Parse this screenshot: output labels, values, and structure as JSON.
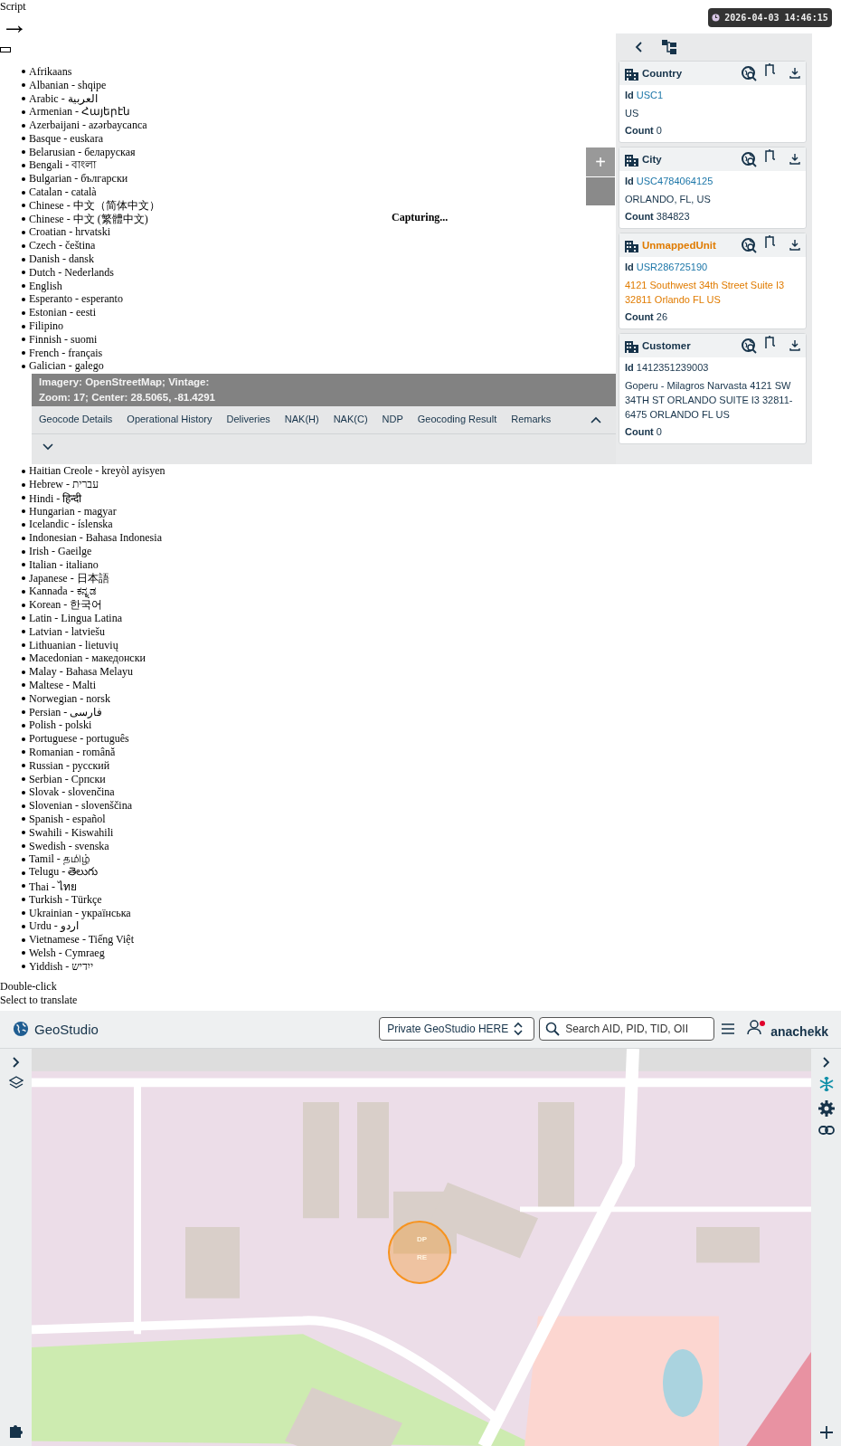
{
  "page_top": {
    "label": "Script",
    "arrow": "→"
  },
  "languages_top": [
    "Afrikaans",
    "Albanian - shqipe",
    "Arabic - العربية",
    "Armenian - Հայերէն",
    "Azerbaijani - azərbaycanca",
    "Basque - euskara",
    "Belarusian - беларуская",
    "Bengali - বাংলা",
    "Bulgarian - български",
    "Catalan - català",
    "Chinese - 中文（简体中文）",
    "Chinese - 中文 (繁體中文)",
    "Croatian - hrvatski",
    "Czech - čeština",
    "Danish - dansk",
    "Dutch - Nederlands",
    "English",
    "Esperanto - esperanto",
    "Estonian - eesti",
    "Filipino",
    "Finnish - suomi",
    "French - français",
    "Galician - galego"
  ],
  "languages_bottom": [
    "Haitian Creole - kreyòl ayisyen",
    "Hebrew - עברית",
    "Hindi - हिन्दी",
    "Hungarian - magyar",
    "Icelandic - íslenska",
    "Indonesian - Bahasa Indonesia",
    "Irish - Gaeilge",
    "Italian - italiano",
    "Japanese - 日本語",
    "Kannada - ಕನ್ನಡ",
    "Korean - 한국어",
    "Latin - Lingua Latina",
    "Latvian - latviešu",
    "Lithuanian - lietuvių",
    "Macedonian - македонски",
    "Malay - Bahasa Melayu",
    "Maltese - Malti",
    "Norwegian - norsk",
    "Persian - فارسی",
    "Polish - polski",
    "Portuguese - português",
    "Romanian - română",
    "Russian - русский",
    "Serbian - Српски",
    "Slovak - slovenčina",
    "Slovenian - slovenščina",
    "Spanish - español",
    "Swahili - Kiswahili",
    "Swedish - svenska",
    "Tamil - தமிழ்",
    "Telugu - తెలుగు",
    "Thai - ไทย",
    "Turkish - Türkçe",
    "Ukrainian - українська",
    "Urdu - اردو",
    "Vietnamese - Tiếng Việt",
    "Welsh - Cymraeg",
    "Yiddish - ייִדיש"
  ],
  "hints": [
    "Double-click",
    "Select to translate"
  ],
  "timestamp": "2026-04-03 14:46:15",
  "capture_status": "Capturing...",
  "map_controls": {
    "zoom_in": "+"
  },
  "map_info": [
    "Imagery: OpenStreetMap; Vintage:",
    "Zoom: 17; Center: 28.5065, -81.4291"
  ],
  "detail_tabs": [
    {
      "label": "Geocode Details",
      "selected": false
    },
    {
      "label": "Operational History",
      "selected": false
    },
    {
      "label": "Deliveries",
      "selected": false
    },
    {
      "label": "NAK(H)",
      "selected": false
    },
    {
      "label": "NAK(C)",
      "selected": false
    },
    {
      "label": "NDP",
      "selected": false
    },
    {
      "label": "Geocoding Result",
      "selected": false
    },
    {
      "label": "Remarks",
      "selected": false
    }
  ],
  "hierarchy": [
    {
      "title": "Country",
      "highlighted": false,
      "id_label": "Id",
      "id": "USC1",
      "id_linked": true,
      "address": "US",
      "count_label": "Count",
      "count": "0"
    },
    {
      "title": "City",
      "highlighted": false,
      "id_label": "Id",
      "id": "USC4784064125",
      "id_linked": true,
      "address": "ORLANDO, FL, US",
      "count_label": "Count",
      "count": "384823"
    },
    {
      "title": "UnmappedUnit",
      "highlighted": true,
      "id_label": "Id",
      "id": "USR286725190",
      "id_linked": true,
      "address": "4121 Southwest 34th Street Suite I3 32811 Orlando FL US",
      "count_label": "Count",
      "count": "26"
    },
    {
      "title": "Customer",
      "highlighted": false,
      "id_label": "Id",
      "id": "1412351239003",
      "id_linked": false,
      "address": "Goperu - Milagros Narvasta 4121 SW 34TH ST ORLANDO SUITE I3 32811-6475 ORLANDO FL US",
      "count_label": "Count",
      "count": "0"
    }
  ],
  "app_header": {
    "brand": "GeoStudio",
    "workspace": "Private GeoStudio HERE",
    "search_placeholder": "Search AID, PID, TID, OII",
    "notification": true,
    "user": "anachekk"
  },
  "map_marker": {
    "labels": [
      "DP",
      "RE"
    ]
  }
}
